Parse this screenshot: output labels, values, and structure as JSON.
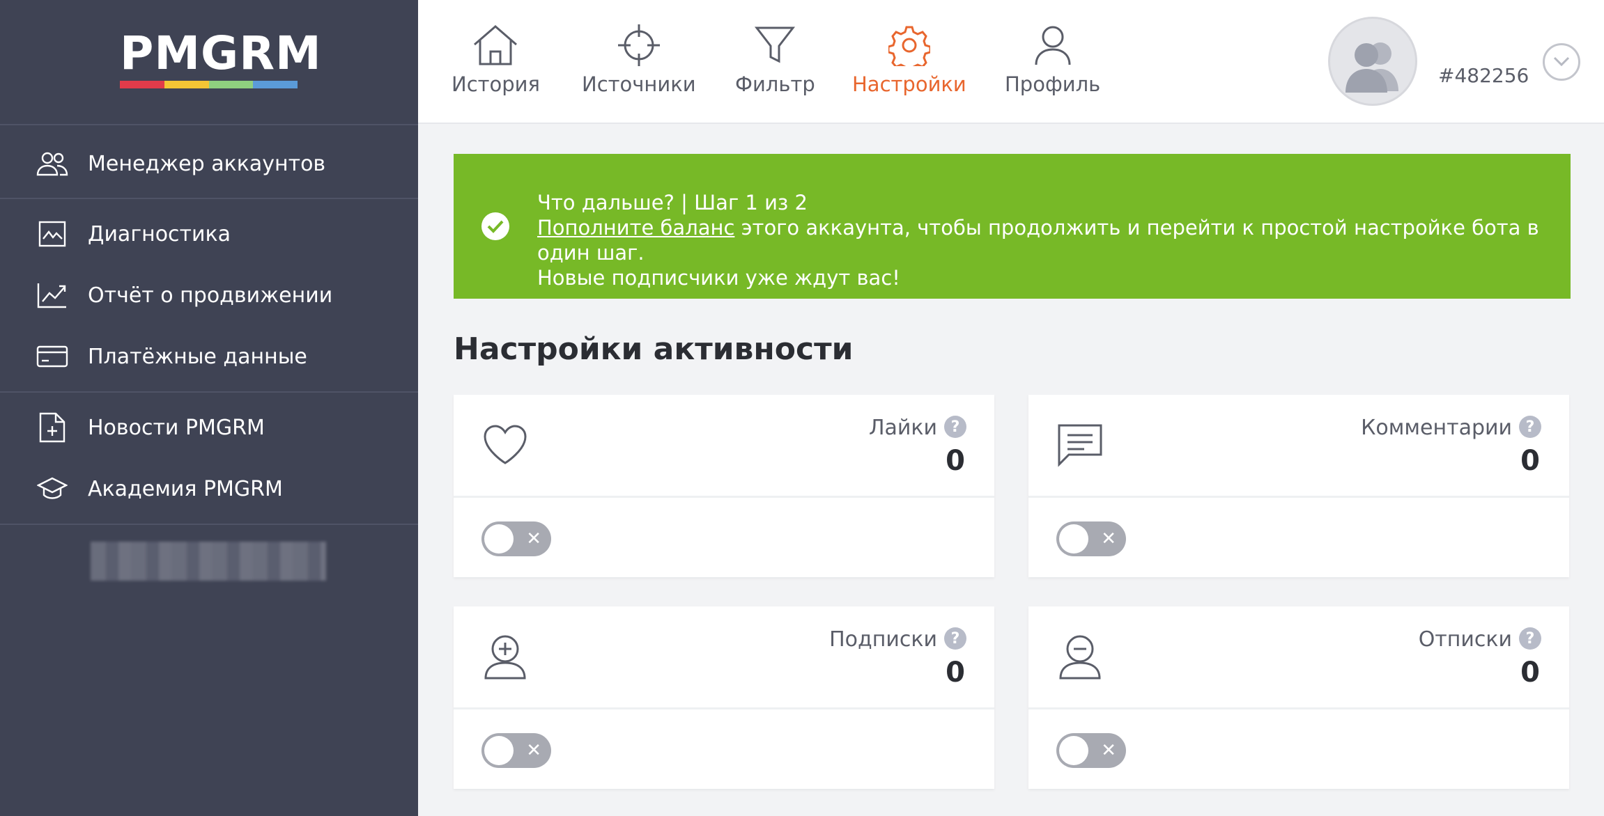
{
  "brand": {
    "logo_text": "PMGRM",
    "logo_colors": [
      "#e23b4a",
      "#f4c535",
      "#8fcf7f",
      "#5b9bd8"
    ]
  },
  "sidebar": {
    "items": [
      {
        "label": "Менеджер аккаунтов",
        "icon": "users-icon"
      },
      {
        "label": "Диагностика",
        "icon": "chart-box-icon"
      },
      {
        "label": "Отчёт о продвижении",
        "icon": "trend-icon"
      },
      {
        "label": "Платёжные данные",
        "icon": "credit-card-icon"
      },
      {
        "label": "Новости PMGRM",
        "icon": "news-add-icon"
      },
      {
        "label": "Академия PMGRM",
        "icon": "graduation-cap-icon"
      }
    ]
  },
  "nav": {
    "items": [
      {
        "label": "История",
        "icon": "home-icon",
        "active": false
      },
      {
        "label": "Источники",
        "icon": "crosshair-icon",
        "active": false
      },
      {
        "label": "Фильтр",
        "icon": "filter-icon",
        "active": false
      },
      {
        "label": "Настройки",
        "icon": "gear-icon",
        "active": true
      },
      {
        "label": "Профиль",
        "icon": "user-icon",
        "active": false
      }
    ],
    "user_id": "#482256"
  },
  "banner": {
    "line1": "Что дальше? | Шаг 1 из 2",
    "link": "Пополните баланс",
    "line2_rest": " этого аккаунта, чтобы продолжить и перейти к простой настройке бота в один шаг.",
    "line3": "Новые подписчики уже ждут вас!"
  },
  "section": {
    "title": "Настройки активности"
  },
  "cards": [
    {
      "title": "Лайки",
      "value": "0",
      "icon": "heart-icon",
      "enabled": false
    },
    {
      "title": "Комментарии",
      "value": "0",
      "icon": "comment-icon",
      "enabled": false
    },
    {
      "title": "Подписки",
      "value": "0",
      "icon": "user-plus-icon",
      "enabled": false
    },
    {
      "title": "Отписки",
      "value": "0",
      "icon": "user-minus-icon",
      "enabled": false
    }
  ],
  "colors": {
    "sidebar_bg": "#3f4354",
    "accent": "#e8662e",
    "banner_bg": "#77b927",
    "toggle_off": "#a8aab2"
  },
  "glyphs": {
    "help": "?",
    "toggle_off": "✕"
  }
}
